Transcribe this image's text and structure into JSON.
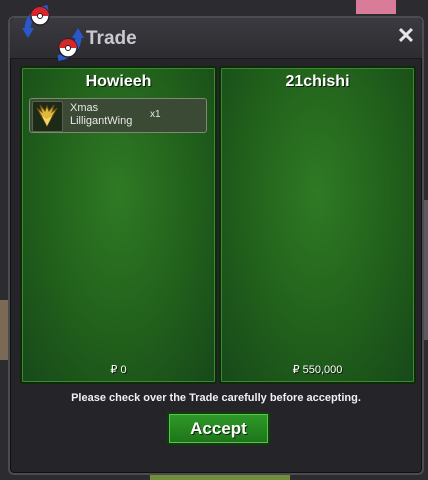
{
  "dialog": {
    "title": "Trade",
    "close_icon": "close-icon",
    "logo_icon": "pokeball-swap-icon"
  },
  "left_panel": {
    "name": "Howieeh",
    "money": "₽ 0",
    "items": [
      {
        "name": "Xmas LilligantWing",
        "qty": "x1",
        "icon": "wing-icon"
      }
    ]
  },
  "right_panel": {
    "name": "21chishi",
    "money": "₽ 550,000",
    "items": []
  },
  "notice": "Please check over the Trade carefully before accepting.",
  "accept_label": "Accept",
  "colors": {
    "panel_green": "#21601b",
    "accept_green": "#2f9a2a",
    "dialog_bg": "#242429"
  }
}
